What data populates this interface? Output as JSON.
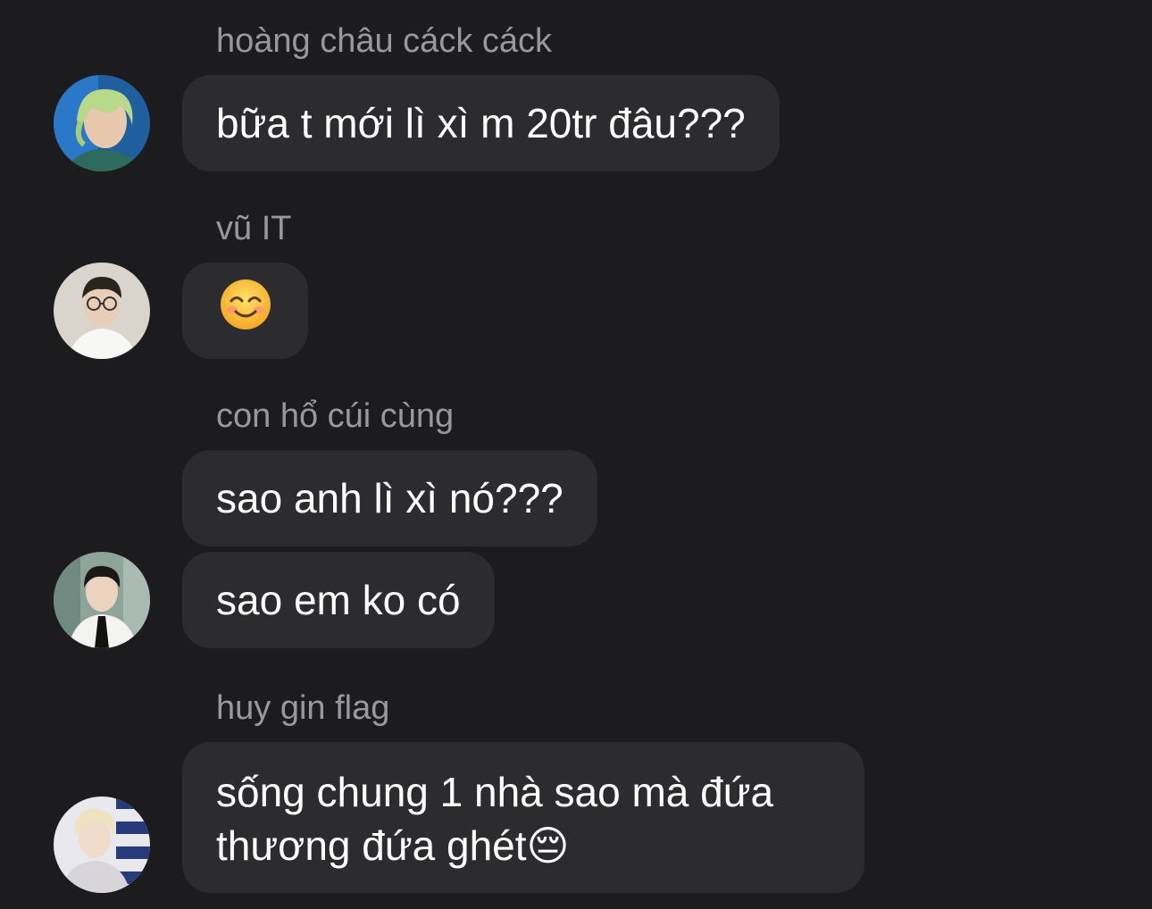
{
  "messages": [
    {
      "sender": "hoàng châu các​k các​k",
      "avatar_icon": "avatar-photo-green-hair",
      "bubbles": [
        "bữa t mới lì xì m 20tr đâu???"
      ]
    },
    {
      "sender": "vũ IT",
      "avatar_icon": "avatar-photo-glasses",
      "bubbles": [
        "😊"
      ]
    },
    {
      "sender": "con hổ cúi cùng",
      "avatar_icon": "avatar-photo-suit-tie",
      "bubbles": [
        "sao anh lì xì nó???",
        "sao em ko có"
      ]
    },
    {
      "sender": "huy gin flag",
      "avatar_icon": "avatar-photo-blond",
      "bubbles": [
        "sống chung 1 nhà sao mà đứa",
        "thương đứa ghét😔"
      ]
    }
  ],
  "colors": {
    "background": "#1c1c1e",
    "bubble": "#2c2c2e",
    "sender_name": "#98989f",
    "text": "#ffffff"
  }
}
